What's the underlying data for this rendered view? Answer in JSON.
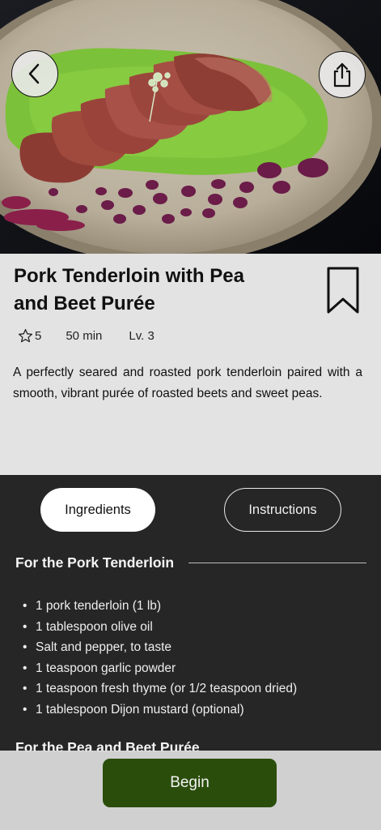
{
  "hero": {
    "image_alt": "pork-tenderloin-dish-photo"
  },
  "nav": {
    "back_icon": "chevron-left-icon",
    "share_icon": "share-icon"
  },
  "recipe": {
    "title": "Pork Tenderloin with Pea and Beet Purée",
    "rating": "5",
    "time": "50 min",
    "level": "Lv. 3",
    "description": "A perfectly seared and roasted pork tenderloin paired with a smooth, vibrant purée of roasted beets and sweet peas."
  },
  "tabs": [
    {
      "label": "Ingredients",
      "selected": true
    },
    {
      "label": "Instructions",
      "selected": false
    }
  ],
  "sections": [
    {
      "title": "For the Pork Tenderloin",
      "items": [
        "1 pork tenderloin (1 lb)",
        "1 tablespoon olive oil",
        "Salt and pepper, to taste",
        "1 teaspoon garlic powder",
        "1 teaspoon fresh thyme (or 1/2 teaspoon dried)",
        "1 tablespoon Dijon mustard (optional)"
      ]
    },
    {
      "title": "For the Pea and Beet Purée"
    }
  ],
  "bullet": "•",
  "actions": {
    "begin_label": "Begin"
  },
  "colors": {
    "begin_bg": "#2a4d0c",
    "card_bg": "#e3e3e3",
    "dark_bg": "#262626"
  }
}
